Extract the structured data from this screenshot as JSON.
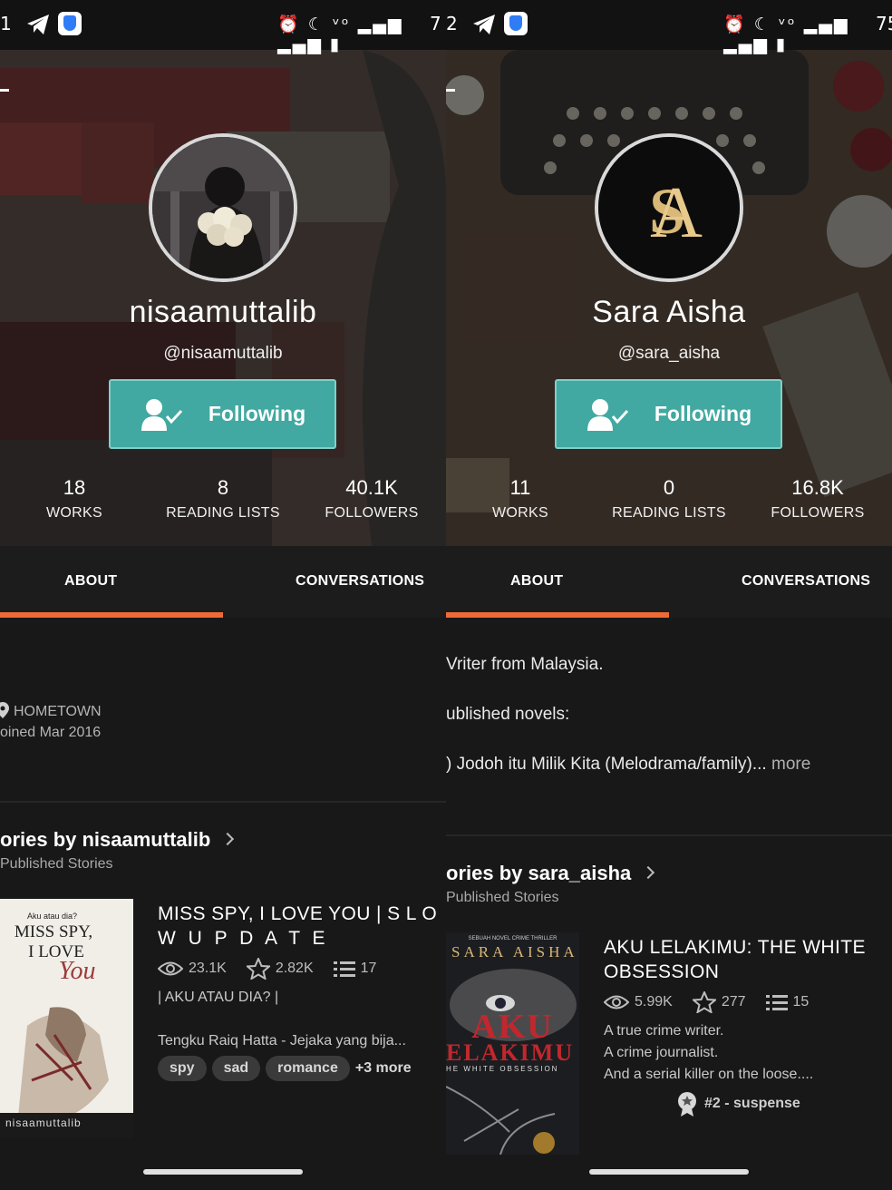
{
  "colors": {
    "accent": "#ee6b36",
    "follow_button": "#41a9a1",
    "background": "#181818"
  },
  "left": {
    "status": {
      "time": "1",
      "battery": "7"
    },
    "profile": {
      "display_name": "nisaamuttalib",
      "handle": "@nisaamuttalib",
      "follow_label": "Following"
    },
    "stats": [
      {
        "value": "18",
        "label": "WORKS"
      },
      {
        "value": "8",
        "label": "READING LISTS"
      },
      {
        "value": "40.1K",
        "label": "FOLLOWERS"
      }
    ],
    "tabs": [
      {
        "label": "ABOUT",
        "active": true
      },
      {
        "label": "CONVERSATIONS",
        "active": false
      }
    ],
    "about": {
      "hometown": "HOMETOWN",
      "joined": "oined Mar 2016"
    },
    "stories": {
      "title": "ories by nisaamuttalib",
      "subtitle": "Published Stories"
    },
    "book": {
      "cover_text": {
        "top": "Aku atau dia?",
        "line1": "MISS SPY,",
        "line2": "I LOVE",
        "line3": "You",
        "author": "nisaamuttalib"
      },
      "title_line1": "MISS SPY, I LOVE YOU | S L O",
      "title_line2": "W U P D A T E",
      "reads": "23.1K",
      "votes": "2.82K",
      "parts": "17",
      "desc1": "| AKU ATAU DIA? |",
      "desc2": "Tengku Raiq Hatta - Jejaka yang bija...",
      "tags": [
        "spy",
        "sad",
        "romance"
      ],
      "more_tags": "+3 more"
    }
  },
  "right": {
    "status": {
      "time": "2",
      "battery": "75"
    },
    "profile": {
      "display_name": "Sara Aisha",
      "handle": "@sara_aisha",
      "follow_label": "Following"
    },
    "stats": [
      {
        "value": "11",
        "label": "WORKS"
      },
      {
        "value": "0",
        "label": "READING LISTS"
      },
      {
        "value": "16.8K",
        "label": "FOLLOWERS"
      }
    ],
    "tabs": [
      {
        "label": "ABOUT",
        "active": true
      },
      {
        "label": "CONVERSATIONS",
        "active": false
      }
    ],
    "about": {
      "line1": "Vriter from Malaysia.",
      "line2": "ublished novels:",
      "line3": ") Jodoh itu Milik Kita (Melodrama/family)...",
      "more": " more"
    },
    "stories": {
      "title": "ories by sara_aisha",
      "subtitle": "Published Stories"
    },
    "book": {
      "cover_text": {
        "top": "SEBUAH NOVEL CRIME THRILLER",
        "author": "SARA AISHA",
        "title1": "AKU",
        "title2": "ELAKIMU",
        "tagline": "HE WHITE OBSESSION"
      },
      "title_line1": "AKU LELAKIMU: THE WHITE",
      "title_line2": "OBSESSION",
      "reads": "5.99K",
      "votes": "277",
      "parts": "15",
      "desc1": "A true crime writer.",
      "desc2": "A crime journalist.",
      "desc3": "And a serial killer on the loose....",
      "rank": "#2 - suspense"
    }
  }
}
